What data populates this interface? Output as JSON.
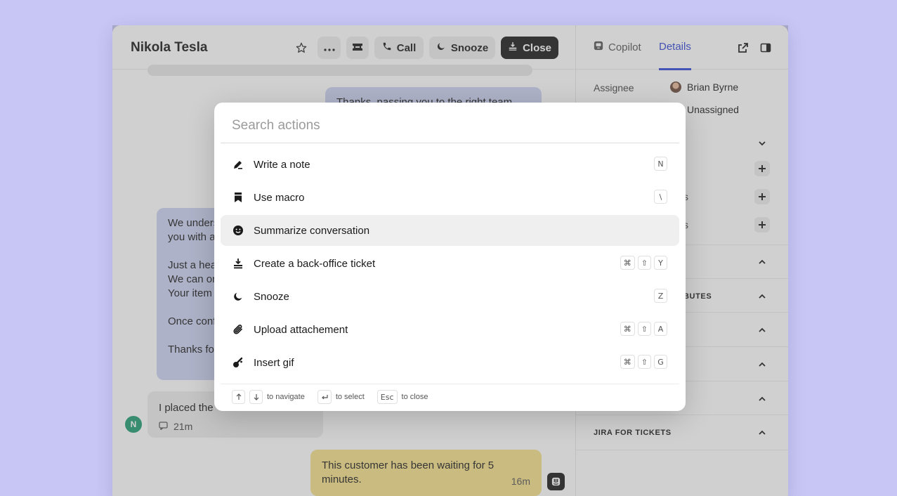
{
  "conversation": {
    "contact_name": "Nikola Tesla",
    "buttons": {
      "call": "Call",
      "snooze": "Snooze",
      "close": "Close"
    },
    "messages": {
      "agent_reply": "Thanks, passing you to the right team now.",
      "long_lines": [
        "We unders",
        "you with a",
        "Just a hea",
        "We can or",
        "Your item",
        "Once conf",
        "Thanks fo"
      ],
      "customer_text": "I placed the",
      "customer_time": "21m",
      "customer_initial": "N",
      "note_text": "This customer has been waiting for 5 minutes.",
      "note_time": "16m"
    }
  },
  "details": {
    "tabs": {
      "copilot": "Copilot",
      "details": "Details"
    },
    "assignee_label": "Assignee",
    "assignee_value": "Brian Byrne",
    "team_value": "Unassigned",
    "partial_labels": {
      "row1": "s",
      "row2": "s"
    },
    "sections": {
      "attributes_partial": "BUTES",
      "jira": "JIRA FOR TICKETS"
    }
  },
  "palette": {
    "placeholder": "Search actions",
    "actions": [
      {
        "label": "Write a note",
        "icon": "pen-icon",
        "keys": [
          "N"
        ]
      },
      {
        "label": "Use macro",
        "icon": "bookmark-icon",
        "keys": [
          "\\"
        ]
      },
      {
        "label": "Summarize conversation",
        "icon": "smile-icon",
        "keys": []
      },
      {
        "label": "Create a back-office ticket",
        "icon": "ticket-icon",
        "keys": [
          "⌘",
          "⇧",
          "Y"
        ]
      },
      {
        "label": "Snooze",
        "icon": "moon-icon",
        "keys": [
          "Z"
        ]
      },
      {
        "label": "Upload attachement",
        "icon": "paperclip-icon",
        "keys": [
          "⌘",
          "⇧",
          "A"
        ]
      },
      {
        "label": "Insert gif",
        "icon": "gif-icon",
        "keys": [
          "⌘",
          "⇧",
          "G"
        ]
      }
    ],
    "footer": {
      "navigate_hint": "to navigate",
      "select_hint": "to select",
      "esc_key": "Esc",
      "close_hint": "to close"
    }
  },
  "colors": {
    "background": "#c7c6f4",
    "accent": "#3347d6",
    "agent_bubble": "#ccd3f4",
    "note_bubble": "#f6e08a",
    "customer_avatar": "#1f9d74"
  }
}
